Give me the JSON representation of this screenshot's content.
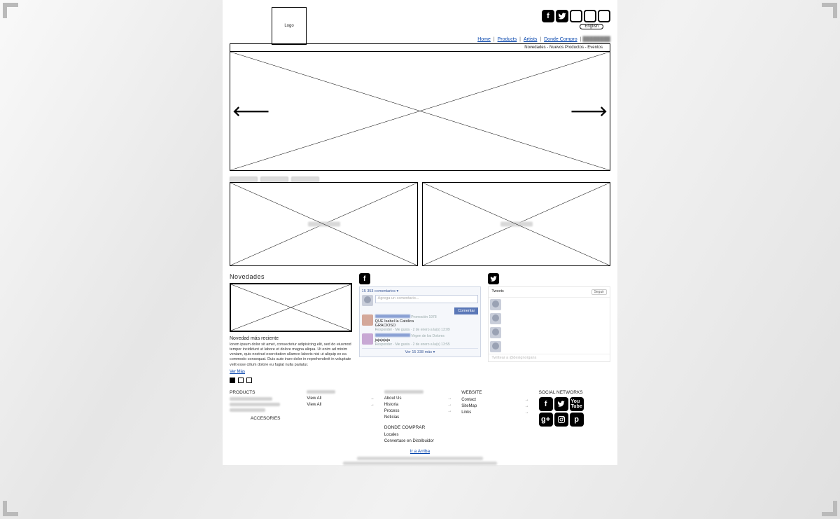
{
  "header": {
    "logo_label": "Logo",
    "language": "English",
    "nav": [
      "Home",
      "Products",
      "Artists",
      "Donde Compro"
    ],
    "sub_bar": "Novedades - Nuevos Productos - Eventos"
  },
  "novedades": {
    "title": "Novedades",
    "subtitle": "Novedad más reciente",
    "body": "lorem ipsum dolor sit amet, consectetur adipisicing elit, sed do eiusmod tempor incididunt ut labore et dolore magna aliqua. Ut enim ad minim veniam, quis nostrud exercitation ullamco laboris nisi ut aliquip ex ea commodo consequat. Duis aute irure dolor in reprehenderit in voluptate velit esse cillum dolore eu fugiat nulla pariatur.",
    "more": "Ver Más"
  },
  "facebook": {
    "count_label": "15 353 comentarios ▾",
    "input_placeholder": "Agrega un comentario...",
    "comment_btn": "Comentar",
    "comments": [
      {
        "extra": "Promoción 1978",
        "body": "QUE Isabel la Católica",
        "body2": "GRACIOSO",
        "meta": "Responder · Me gusta · 2 de enero a la(s) 13:09"
      },
      {
        "extra": "Virgen de los Dolores",
        "body": "jajajajaja",
        "meta": "Responder · Me gusta · 2 de enero a la(s) 13:55"
      }
    ],
    "more": "Ver 15 338 más ▾"
  },
  "twitter": {
    "title": "Tweets",
    "follow": "Seguir",
    "input_placeholder": "Twittear a @designorgans"
  },
  "footer": {
    "col1_title": "PRODUCTS",
    "accesories": "ACCESORIES",
    "col2_view_all": "View All",
    "col3_items": [
      "About Us",
      "Historia",
      "Process",
      "Noticias"
    ],
    "col3_sub_title": "DONDE COMPRAR",
    "col3_sub_items": [
      "Locales",
      "Convertase en Distribuidor"
    ],
    "col4_title": "WEBSITE",
    "col4_items": [
      "Contact",
      "SiteMap",
      "Links"
    ],
    "col5_title": "SOCIAL NETWORKS",
    "go_top": "Ir a Arriba"
  }
}
